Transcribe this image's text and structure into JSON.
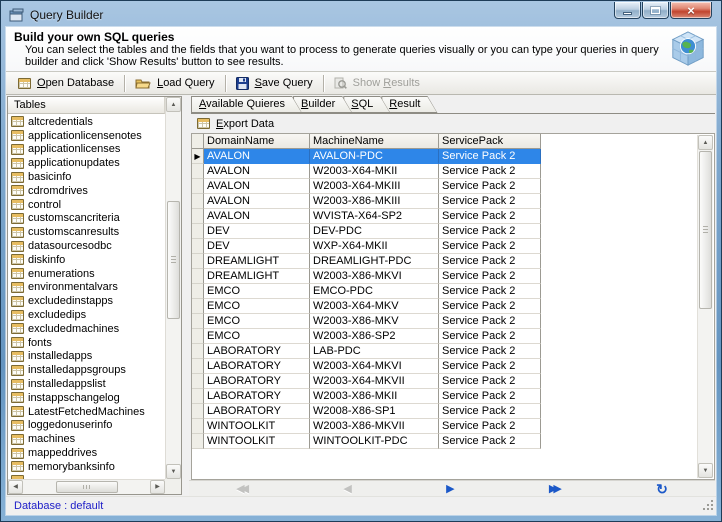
{
  "window": {
    "title": "Query Builder"
  },
  "header": {
    "title": "Build your own SQL queries",
    "description": "You can select the tables and the fields that you want to process to generate queries visually or you can type your queries in query builder and click 'Show Results' button to see results."
  },
  "toolbar": {
    "open_database": "Open Database",
    "load_query": "Load Query",
    "save_query": "Save Query",
    "show_results_prefix": "Show ",
    "show_results_word": "Results"
  },
  "tables_panel": {
    "header": "Tables",
    "items": [
      "altcredentials",
      "applicationlicensenotes",
      "applicationlicenses",
      "applicationupdates",
      "basicinfo",
      "cdromdrives",
      "control",
      "customscancriteria",
      "customscanresults",
      "datasourcesodbc",
      "diskinfo",
      "enumerations",
      "environmentalvars",
      "excludedinstapps",
      "excludedips",
      "excludedmachines",
      "fonts",
      "installedapps",
      "installedappsgroups",
      "installedappslist",
      "instappschangelog",
      "LatestFetchedMachines",
      "loggedonuserinfo",
      "machines",
      "mappeddrives",
      "memorybanksinfo"
    ]
  },
  "tabs": [
    {
      "label": "Available Quieres",
      "active": false
    },
    {
      "label": "Builder",
      "active": false
    },
    {
      "label": "SQL",
      "active": false
    },
    {
      "label": "Result",
      "active": true
    }
  ],
  "result_view": {
    "export_button": "Export Data"
  },
  "grid": {
    "columns": [
      "DomainName",
      "MachineName",
      "ServicePack"
    ],
    "selected_row_index": 0,
    "rows": [
      [
        "AVALON",
        "AVALON-PDC",
        "Service Pack 2"
      ],
      [
        "AVALON",
        "W2003-X64-MKII",
        "Service Pack 2"
      ],
      [
        "AVALON",
        "W2003-X64-MKIII",
        "Service Pack 2"
      ],
      [
        "AVALON",
        "W2003-X86-MKIII",
        "Service Pack 2"
      ],
      [
        "AVALON",
        "WVISTA-X64-SP2",
        "Service Pack 2"
      ],
      [
        "DEV",
        "DEV-PDC",
        "Service Pack 2"
      ],
      [
        "DEV",
        "WXP-X64-MKII",
        "Service Pack 2"
      ],
      [
        "DREAMLIGHT",
        "DREAMLIGHT-PDC",
        "Service Pack 2"
      ],
      [
        "DREAMLIGHT",
        "W2003-X86-MKVI",
        "Service Pack 2"
      ],
      [
        "EMCO",
        "EMCO-PDC",
        "Service Pack 2"
      ],
      [
        "EMCO",
        "W2003-X64-MKV",
        "Service Pack 2"
      ],
      [
        "EMCO",
        "W2003-X86-MKV",
        "Service Pack 2"
      ],
      [
        "EMCO",
        "W2003-X86-SP2",
        "Service Pack 2"
      ],
      [
        "LABORATORY",
        "LAB-PDC",
        "Service Pack 2"
      ],
      [
        "LABORATORY",
        "W2003-X64-MKVI",
        "Service Pack 2"
      ],
      [
        "LABORATORY",
        "W2003-X64-MKVII",
        "Service Pack 2"
      ],
      [
        "LABORATORY",
        "W2003-X86-MKII",
        "Service Pack 2"
      ],
      [
        "LABORATORY",
        "W2008-X86-SP1",
        "Service Pack 2"
      ],
      [
        "WINTOOLKIT",
        "W2003-X86-MKVII",
        "Service Pack 2"
      ],
      [
        "WINTOOLKIT",
        "WINTOOLKIT-PDC",
        "Service Pack 2"
      ]
    ]
  },
  "result_nav": {
    "buttons": [
      {
        "name": "first",
        "glyph": "◀◀",
        "enabled": false
      },
      {
        "name": "previous",
        "glyph": "◀",
        "enabled": false
      },
      {
        "name": "next",
        "glyph": "▶",
        "enabled": true
      },
      {
        "name": "last",
        "glyph": "▶▶",
        "enabled": true
      },
      {
        "name": "refresh",
        "glyph": "↻",
        "enabled": true
      }
    ]
  },
  "statusbar": {
    "text": "Database : default"
  },
  "colors": {
    "selection": "#2E86E8",
    "status_text": "#2020C8",
    "nav_enabled": "#1B58C8",
    "nav_disabled": "#C2C2C0",
    "titlebar_blue": "#7EA7CD",
    "close_button_red": "#C1442E"
  }
}
